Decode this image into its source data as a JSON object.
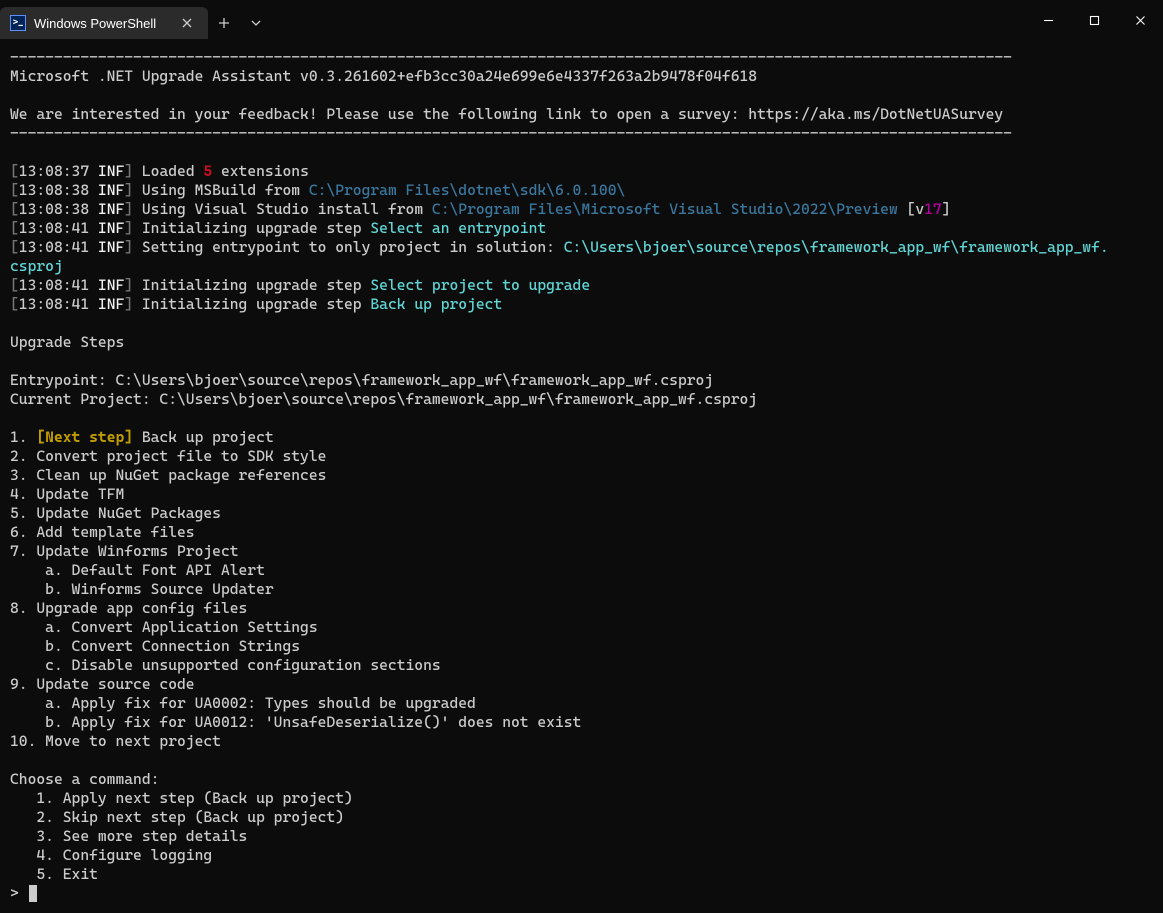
{
  "titlebar": {
    "tab_icon_label": ">_",
    "tab_title": "Windows PowerShell"
  },
  "hr": "------------------------------------------------------------------------------------------------------------------",
  "header_line": "Microsoft .NET Upgrade Assistant v0.3.261602+efb3cc30a24e699e6e4337f263a2b9478f04f618",
  "survey_line": "We are interested in your feedback! Please use the following link to open a survey: https://aka.ms/DotNetUASurvey",
  "log_level": "INF",
  "logs": {
    "l1": {
      "time": "13:08:37",
      "text_a": " Loaded ",
      "num": "5",
      "text_b": " extensions"
    },
    "l2": {
      "time": "13:08:38",
      "text_a": " Using MSBuild from ",
      "path": "C:\\Program Files\\dotnet\\sdk\\6.0.100\\"
    },
    "l3": {
      "time": "13:08:38",
      "text_a": " Using Visual Studio install from ",
      "path": "C:\\Program Files\\Microsoft Visual Studio\\2022\\Preview",
      "suffix_a": " [",
      "v": "v",
      "ver": "17",
      "suffix_b": "]"
    },
    "l4": {
      "time": "13:08:41",
      "text_a": " Initializing upgrade step ",
      "step": "Select an entrypoint"
    },
    "l5": {
      "time": "13:08:41",
      "text_a": " Setting entrypoint to only project in solution: ",
      "path": "C:\\Users\\bjoer\\source\\repos\\framework_app_wf\\framework_app_wf.",
      "path2": "csproj"
    },
    "l6": {
      "time": "13:08:41",
      "text_a": " Initializing upgrade step ",
      "step": "Select project to upgrade"
    },
    "l7": {
      "time": "13:08:41",
      "text_a": " Initializing upgrade step ",
      "step": "Back up project"
    }
  },
  "steps_header": "Upgrade Steps",
  "entrypoint_line": "Entrypoint: C:\\Users\\bjoer\\source\\repos\\framework_app_wf\\framework_app_wf.csproj",
  "current_project_line": "Current Project: C:\\Users\\bjoer\\source\\repos\\framework_app_wf\\framework_app_wf.csproj",
  "next_step_label": "[Next step]",
  "steps": {
    "s1_prefix": "1. ",
    "s1_text": " Back up project",
    "s2": "2. Convert project file to SDK style",
    "s3": "3. Clean up NuGet package references",
    "s4": "4. Update TFM",
    "s5": "5. Update NuGet Packages",
    "s6": "6. Add template files",
    "s7": "7. Update Winforms Project",
    "s7a": "    a. Default Font API Alert",
    "s7b": "    b. Winforms Source Updater",
    "s8": "8. Upgrade app config files",
    "s8a": "    a. Convert Application Settings",
    "s8b": "    b. Convert Connection Strings",
    "s8c": "    c. Disable unsupported configuration sections",
    "s9": "9. Update source code",
    "s9a": "    a. Apply fix for UA0002: Types should be upgraded",
    "s9b": "    b. Apply fix for UA0012: 'UnsafeDeserialize()' does not exist",
    "s10": "10. Move to next project"
  },
  "choose_header": "Choose a command:",
  "choices": {
    "c1": "   1. Apply next step (Back up project)",
    "c2": "   2. Skip next step (Back up project)",
    "c3": "   3. See more step details",
    "c4": "   4. Configure logging",
    "c5": "   5. Exit"
  },
  "prompt": "> "
}
